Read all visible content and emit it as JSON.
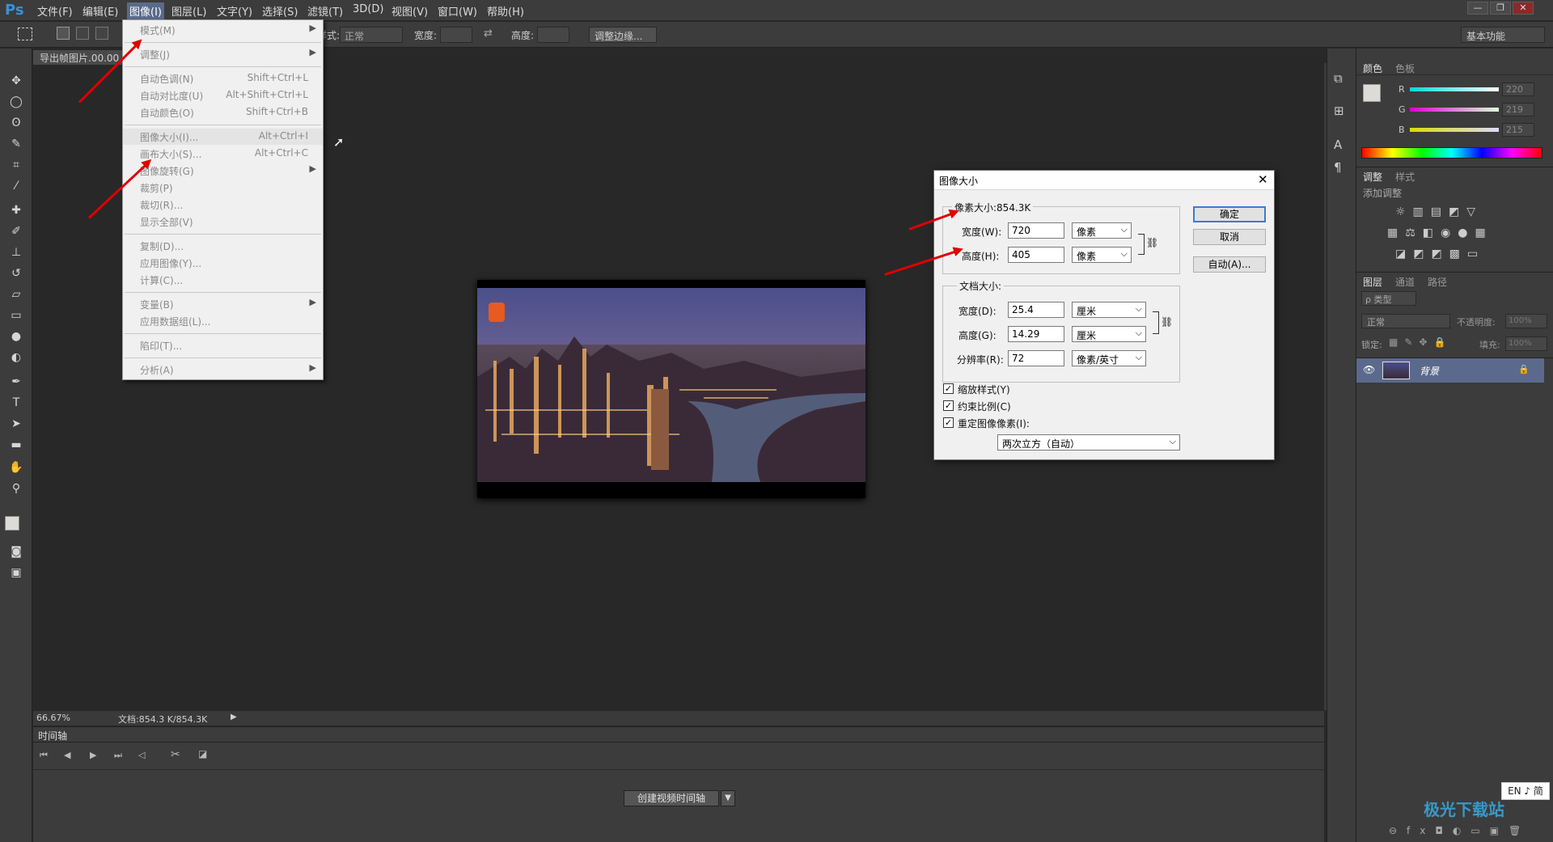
{
  "app": {
    "logo": "Ps"
  },
  "menubar": {
    "items": [
      "文件(F)",
      "编辑(E)",
      "图像(I)",
      "图层(L)",
      "文字(Y)",
      "选择(S)",
      "滤镜(T)",
      "3D(D)",
      "视图(V)",
      "窗口(W)",
      "帮助(H)"
    ],
    "active_index": 2
  },
  "window_controls": {
    "minimize": "—",
    "restore": "❐",
    "close": "✕"
  },
  "options_bar": {
    "style_label": "样式:",
    "style_value": "正常",
    "width_label": "宽度:",
    "height_label": "高度:",
    "refine_button": "调整边缘...",
    "workspace": "基本功能"
  },
  "document": {
    "tab_title": "导出帧图片.00.00"
  },
  "status": {
    "zoom": "66.67%",
    "doc_info": "文档:854.3 K/854.3K"
  },
  "timeline": {
    "title": "时间轴",
    "create_button": "创建视频时间轴"
  },
  "image_menu": {
    "items": [
      {
        "label": "模式(M)",
        "shortcut": "",
        "submenu": true
      },
      {
        "sep": true
      },
      {
        "label": "调整(J)",
        "shortcut": "",
        "submenu": true
      },
      {
        "sep": true
      },
      {
        "label": "自动色调(N)",
        "shortcut": "Shift+Ctrl+L",
        "submenu": false
      },
      {
        "label": "自动对比度(U)",
        "shortcut": "Alt+Shift+Ctrl+L",
        "submenu": false
      },
      {
        "label": "自动颜色(O)",
        "shortcut": "Shift+Ctrl+B",
        "submenu": false
      },
      {
        "sep": true
      },
      {
        "label": "图像大小(I)...",
        "shortcut": "Alt+Ctrl+I",
        "submenu": false,
        "highlight": true
      },
      {
        "label": "画布大小(S)...",
        "shortcut": "Alt+Ctrl+C",
        "submenu": false
      },
      {
        "label": "图像旋转(G)",
        "shortcut": "",
        "submenu": true
      },
      {
        "label": "裁剪(P)",
        "shortcut": "",
        "submenu": false
      },
      {
        "label": "裁切(R)...",
        "shortcut": "",
        "submenu": false
      },
      {
        "label": "显示全部(V)",
        "shortcut": "",
        "submenu": false
      },
      {
        "sep": true
      },
      {
        "label": "复制(D)...",
        "shortcut": "",
        "submenu": false
      },
      {
        "label": "应用图像(Y)...",
        "shortcut": "",
        "submenu": false
      },
      {
        "label": "计算(C)...",
        "shortcut": "",
        "submenu": false
      },
      {
        "sep": true
      },
      {
        "label": "变量(B)",
        "shortcut": "",
        "submenu": true
      },
      {
        "label": "应用数据组(L)...",
        "shortcut": "",
        "submenu": false
      },
      {
        "sep": true
      },
      {
        "label": "陷印(T)...",
        "shortcut": "",
        "submenu": false
      },
      {
        "sep": true
      },
      {
        "label": "分析(A)",
        "shortcut": "",
        "submenu": true
      }
    ]
  },
  "dialog": {
    "title": "图像大小",
    "pixel_dimensions_label": "像素大小:854.3K",
    "px_width_label": "宽度(W):",
    "px_width_value": "720",
    "px_width_unit": "像素",
    "px_height_label": "高度(H):",
    "px_height_value": "405",
    "px_height_unit": "像素",
    "doc_size_label": "文档大小:",
    "doc_width_label": "宽度(D):",
    "doc_width_value": "25.4",
    "doc_width_unit": "厘米",
    "doc_height_label": "高度(G):",
    "doc_height_value": "14.29",
    "doc_height_unit": "厘米",
    "resolution_label": "分辨率(R):",
    "resolution_value": "72",
    "resolution_unit": "像素/英寸",
    "scale_styles_label": "缩放样式(Y)",
    "constrain_label": "约束比例(C)",
    "resample_label": "重定图像像素(I):",
    "resample_method": "两次立方（自动）",
    "ok_button": "确定",
    "cancel_button": "取消",
    "auto_button": "自动(A)..."
  },
  "color_panel": {
    "tabs": [
      "颜色",
      "色板"
    ],
    "r_label": "R",
    "g_label": "G",
    "b_label": "B",
    "r_value": "220",
    "g_value": "219",
    "b_value": "215"
  },
  "adjust_panel": {
    "tabs": [
      "调整",
      "样式"
    ],
    "add_label": "添加调整"
  },
  "layers_panel": {
    "tabs": [
      "图层",
      "通道",
      "路径"
    ],
    "kind_filter": "ρ 类型",
    "blend_mode": "正常",
    "opacity_label": "不透明度:",
    "opacity_value": "100%",
    "lock_label": "锁定:",
    "fill_label": "填充:",
    "fill_value": "100%",
    "layer_name": "背景"
  },
  "ime": {
    "text": "EN ♪ 简"
  },
  "watermark": {
    "text": "极光下载站"
  }
}
